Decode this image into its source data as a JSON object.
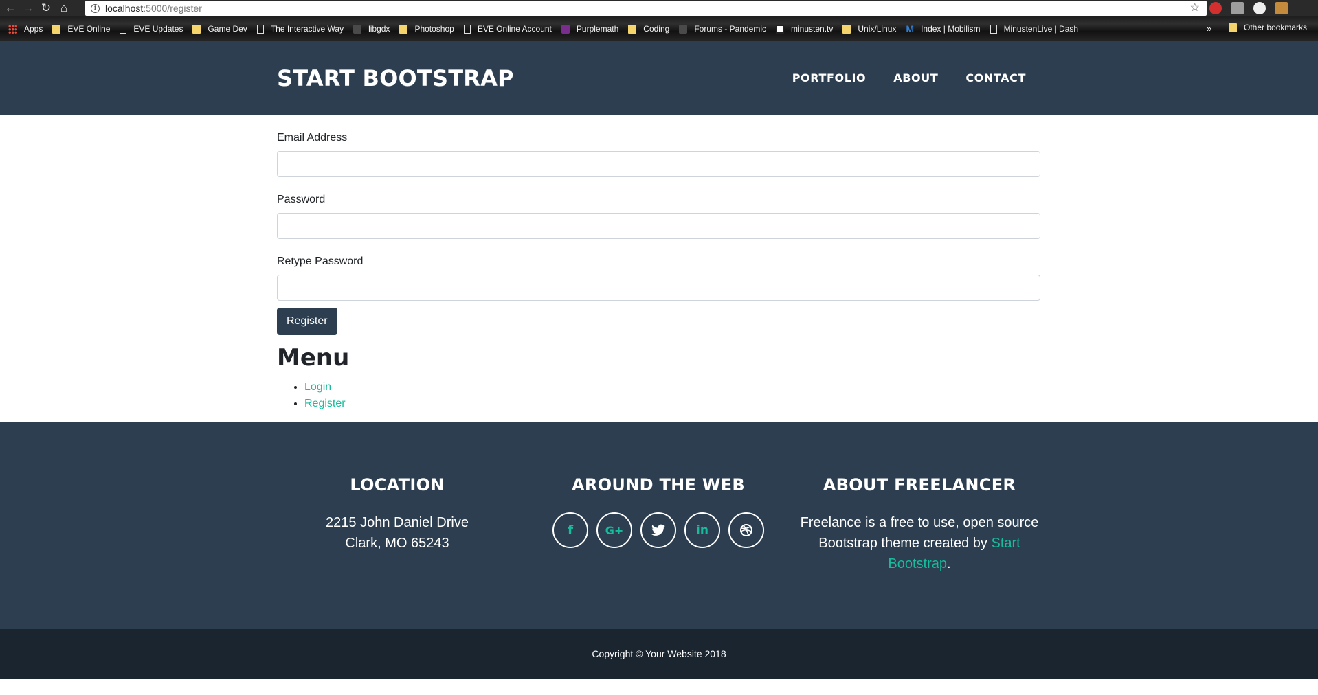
{
  "browser": {
    "url_host": "localhost",
    "url_path": ":5000/register",
    "bookmarks": [
      {
        "label": "Apps",
        "icon": "apps-grid-icon"
      },
      {
        "label": "EVE Online",
        "icon": "folder-icon"
      },
      {
        "label": "EVE Updates",
        "icon": "page-icon"
      },
      {
        "label": "Game Dev",
        "icon": "folder-icon"
      },
      {
        "label": "The Interactive Way",
        "icon": "page-icon"
      },
      {
        "label": "libgdx",
        "icon": "dark-icon"
      },
      {
        "label": "Photoshop",
        "icon": "folder-icon"
      },
      {
        "label": "EVE Online Account",
        "icon": "page-icon"
      },
      {
        "label": "Purplemath",
        "icon": "purple-icon"
      },
      {
        "label": "Coding",
        "icon": "folder-icon"
      },
      {
        "label": "Forums - Pandemic",
        "icon": "dark-icon"
      },
      {
        "label": "minusten.tv",
        "icon": "minu-icon"
      },
      {
        "label": "Unix/Linux",
        "icon": "folder-icon"
      },
      {
        "label": "Index | Mobilism",
        "icon": "mobilism-icon"
      },
      {
        "label": "MinustenLive | Dash",
        "icon": "page-icon"
      }
    ],
    "more": "»",
    "other_bookmarks": "Other bookmarks"
  },
  "header": {
    "brand": "START BOOTSTRAP",
    "nav": [
      "PORTFOLIO",
      "ABOUT",
      "CONTACT"
    ]
  },
  "form": {
    "email_label": "Email Address",
    "password_label": "Password",
    "retype_label": "Retype Password",
    "submit": "Register"
  },
  "menu": {
    "title": "Menu",
    "items": [
      "Login",
      "Register"
    ]
  },
  "footer": {
    "location_title": "LOCATION",
    "address_line1": "2215 John Daniel Drive",
    "address_line2": "Clark, MO 65243",
    "web_title": "AROUND THE WEB",
    "social": [
      {
        "name": "facebook-icon",
        "glyph": "f"
      },
      {
        "name": "google-plus-icon",
        "glyph": "G+"
      },
      {
        "name": "twitter-icon",
        "glyph": "🐦"
      },
      {
        "name": "linkedin-icon",
        "glyph": "in"
      },
      {
        "name": "dribbble-icon",
        "glyph": "⊛"
      }
    ],
    "about_title": "ABOUT FREELANCER",
    "about_text": "Freelance is a free to use, open source Bootstrap theme created by",
    "about_link": "Start Bootstrap",
    "about_end": ".",
    "copyright": "Copyright © Your Website 2018"
  },
  "colors": {
    "primary": "#2c3e50",
    "accent": "#18bc9c",
    "copyright_bg": "#1a252f"
  }
}
